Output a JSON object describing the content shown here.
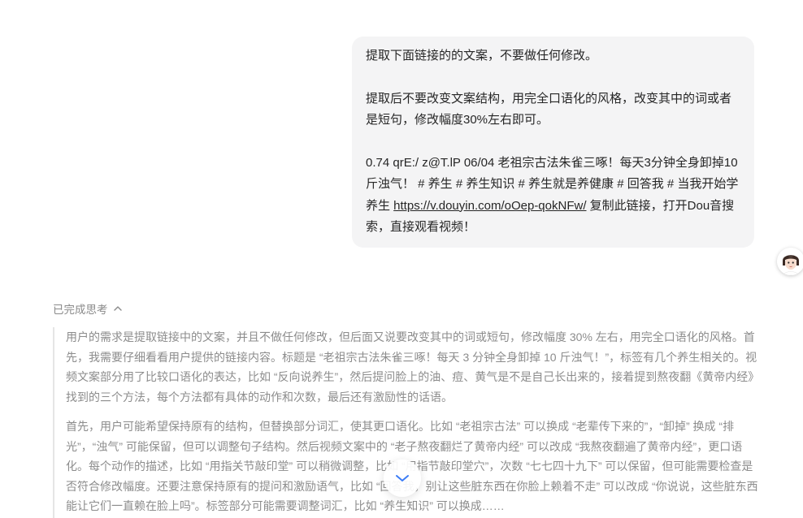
{
  "user_message": {
    "line1": "提取下面链接的的文案，不要做任何修改。",
    "line2": "提取后不要改变文案结构，用完全口语化的风格，改变其中的词或者是短句，修改幅度30%左右即可。",
    "line3_prefix": "0.74 qrE:/ z@T.lP 06/04 老祖宗古法朱雀三啄！每天3分钟全身卸掉10斤浊气！ # 养生 # 养生知识 # 养生就是养健康 # 回答我 # 当我开始学养生 ",
    "line3_link": "https://v.douyin.com/oOep-qokNFw/",
    "line3_suffix": " 复制此链接，打开Dou音搜索，直接观看视频！"
  },
  "thinking": {
    "toggle_label": "已完成思考",
    "paragraph1": "用户的需求是提取链接中的文案，并且不做任何修改，但后面又说要改变其中的词或短句，修改幅度 30% 左右，用完全口语化的风格。首先，我需要仔细看看用户提供的链接内容。标题是 “老祖宗古法朱雀三啄！每天 3 分钟全身卸掉 10 斤浊气！”，标签有几个养生相关的。视频文案部分用了比较口语化的表达，比如 “反向说养生”，然后提问脸上的油、痘、黄气是不是自己长出来的，接着提到熬夜翻《黄帝内经》找到的三个方法，每个方法都有具体的动作和次数，最后还有激励性的话语。",
    "paragraph2": "首先，用户可能希望保持原有的结构，但替换部分词汇，使其更口语化。比如 “老祖宗古法” 可以换成 “老辈传下来的”，“卸掉” 换成 “排光”，“浊气” 可能保留，但可以调整句子结构。然后视频文案中的 “老子熬夜翻烂了黄帝内经” 可以改成 “我熬夜翻遍了黄帝内经”，更口语化。每个动作的描述，比如 “用指关节敲印堂” 可以稍微调整，比如 “用指节敲印堂穴”，次数 “七七四十九下” 可以保留，但可能需要检查是否符合修改幅度。还要注意保持原有的提问和激励语气，比如 “回答我，别让这些脏东西在你脸上赖着不走” 可以改成 “你说说，这些脏东西能让它们一直赖在脸上吗”。标签部分可能需要调整词汇，比如 “养生知识” 可以换成……"
  },
  "icons": {
    "thinking_chevron": "chevron-up-icon",
    "scroll_button": "chevron-down-icon",
    "assistant_avatar": "avatar"
  },
  "colors": {
    "bubble_bg": "#f4f4f5",
    "scroll_chevron": "#3b7cf6",
    "muted_text": "#8c8c8c"
  }
}
